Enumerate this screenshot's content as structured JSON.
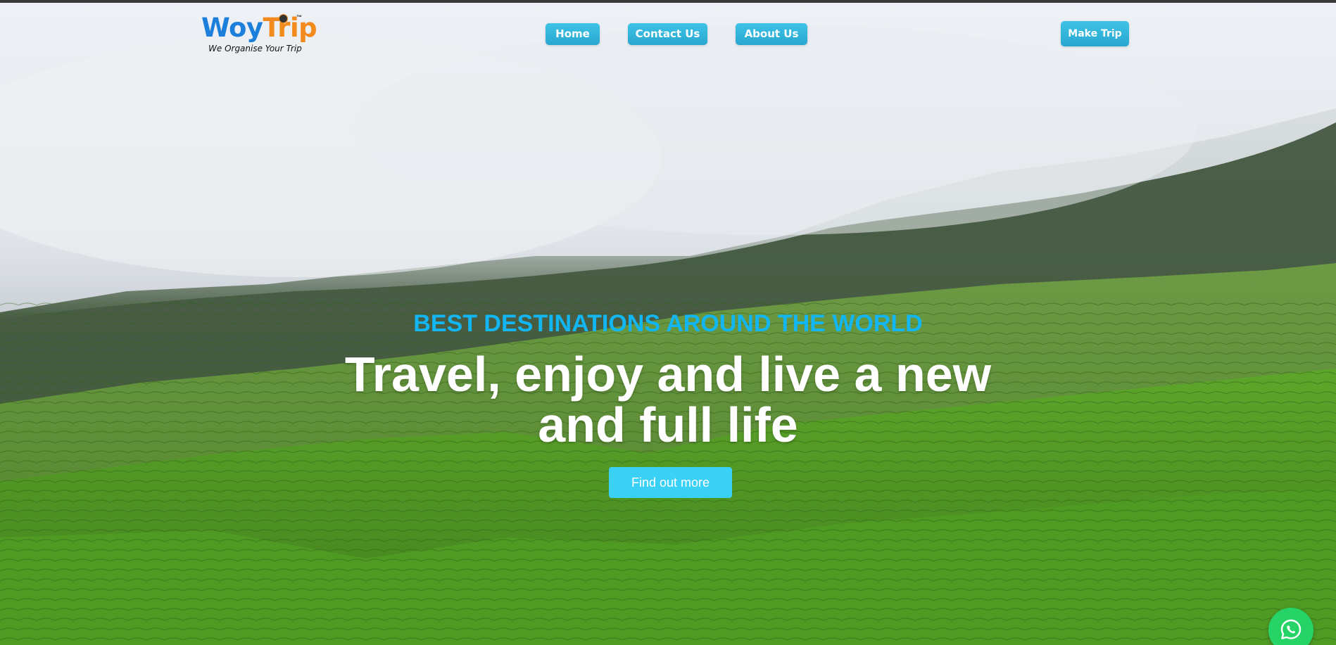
{
  "brand": {
    "name_part1": "Woy",
    "name_part2": "Trip",
    "trademark": "™",
    "tagline": "We Organise Your Trip"
  },
  "nav": {
    "items": [
      {
        "label": "Home"
      },
      {
        "label": "Contact Us"
      },
      {
        "label": "About Us"
      }
    ],
    "cta_label": "Make Trip"
  },
  "hero": {
    "subtitle": "BEST DESTINATIONS AROUND THE WORLD",
    "title_line1": "Travel, enjoy and live a new",
    "title_line2": "and full life",
    "button_label": "Find out more"
  },
  "icons": {
    "chat": "whatsapp-icon"
  },
  "colors": {
    "brand_blue": "#1c7fdc",
    "brand_orange": "#f28a1e",
    "accent_cyan": "#12b6f2",
    "button_cyan": "#3bd0f5",
    "whatsapp_green": "#25d366"
  }
}
